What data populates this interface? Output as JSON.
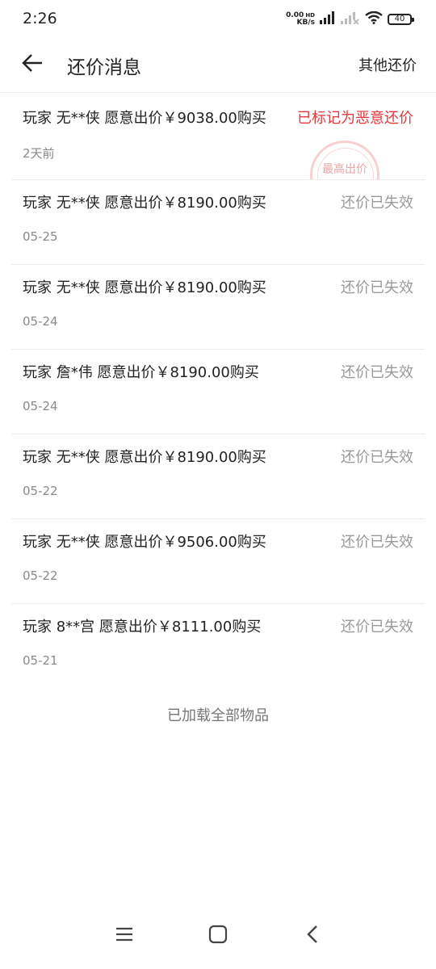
{
  "status_bar": {
    "time": "2:26",
    "net_speed_value": "0.00",
    "net_speed_unit": "KB/s",
    "hd_label": "HD",
    "battery": "40",
    "icons": [
      "signal-icon",
      "signal-no-sim-icon",
      "wifi-icon",
      "battery-icon"
    ]
  },
  "header": {
    "back_icon": "arrow-left-icon",
    "title": "还价消息",
    "other_offers_label": "其他还价"
  },
  "offers": [
    {
      "text": "玩家 无**侠 愿意出价￥9038.00购买",
      "date": "2天前",
      "status": "已标记为恶意还价",
      "flagged": true,
      "stamp": "最高出价"
    },
    {
      "text": "玩家 无**侠 愿意出价￥8190.00购买",
      "date": "05-25",
      "status": "还价已失效",
      "flagged": false
    },
    {
      "text": "玩家 无**侠 愿意出价￥8190.00购买",
      "date": "05-24",
      "status": "还价已失效",
      "flagged": false
    },
    {
      "text": "玩家 詹*伟 愿意出价￥8190.00购买",
      "date": "05-24",
      "status": "还价已失效",
      "flagged": false
    },
    {
      "text": "玩家 无**侠 愿意出价￥8190.00购买",
      "date": "05-22",
      "status": "还价已失效",
      "flagged": false
    },
    {
      "text": "玩家 无**侠 愿意出价￥9506.00购买",
      "date": "05-22",
      "status": "还价已失效",
      "flagged": false
    },
    {
      "text": "玩家 8**宫 愿意出价￥8111.00购买",
      "date": "05-21",
      "status": "还价已失效",
      "flagged": false
    }
  ],
  "footer_text": "已加载全部物品",
  "nav_bar": {
    "icons": [
      "menu-icon",
      "home-square-icon",
      "back-chevron-icon"
    ]
  },
  "colors": {
    "flagged": "#e8363b",
    "expired": "#9a9a9a",
    "stamp": "#e26464"
  }
}
